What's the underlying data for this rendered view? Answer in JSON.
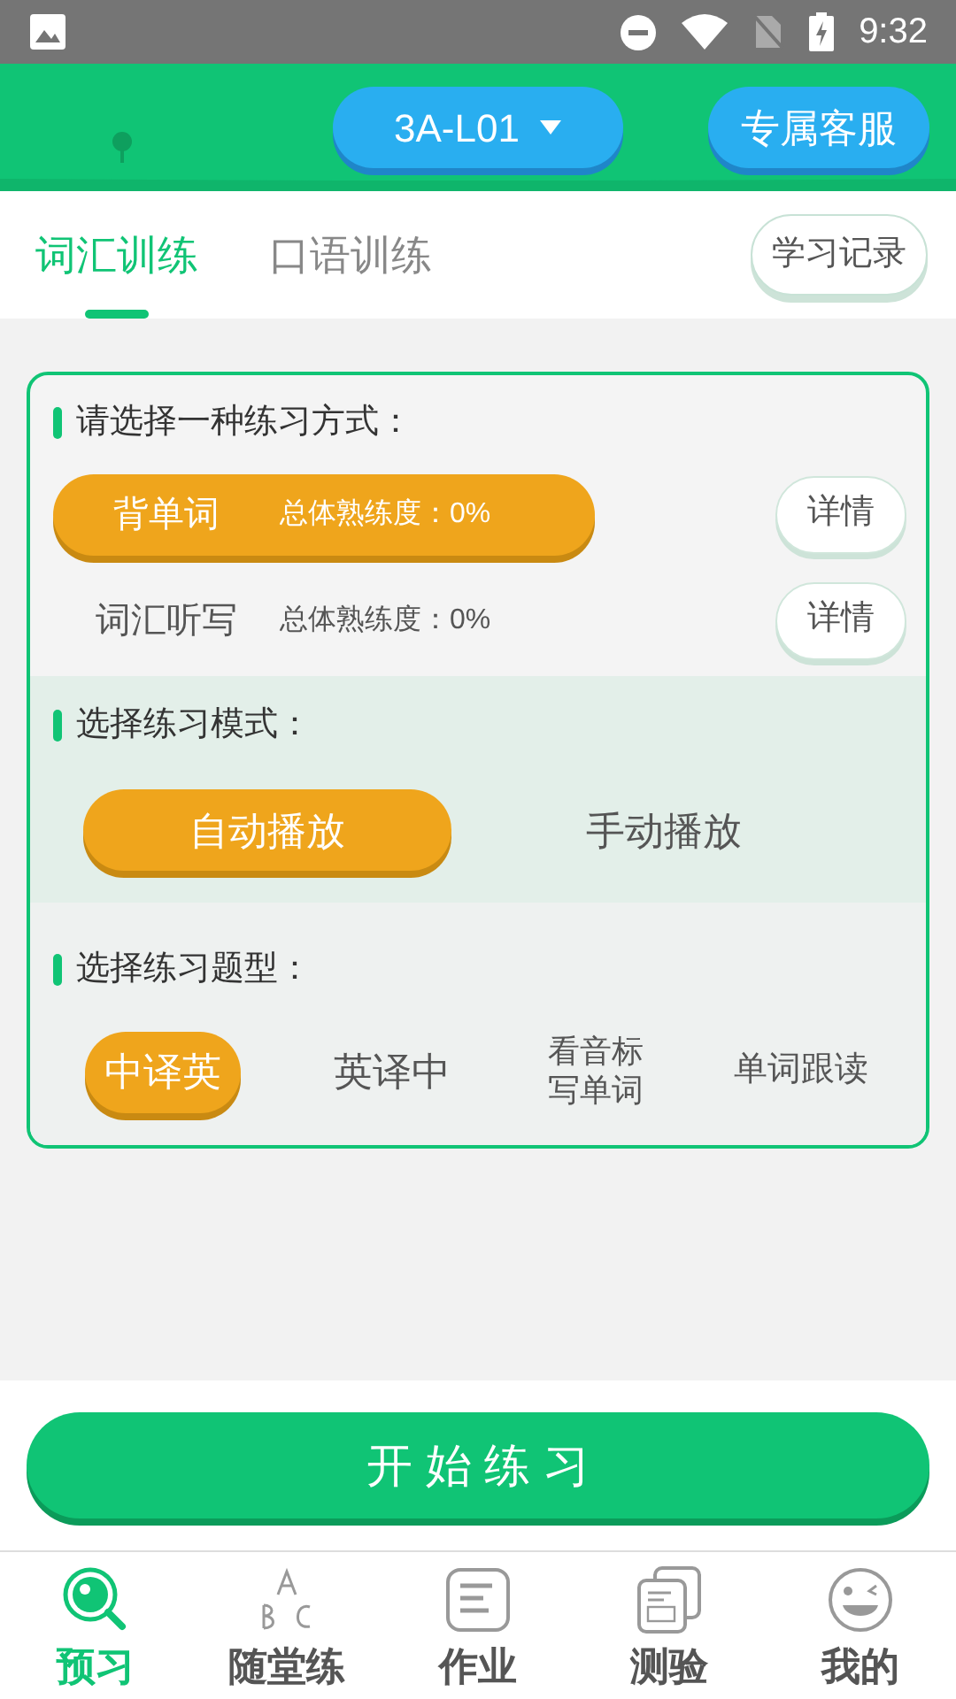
{
  "status_bar": {
    "time": "9:32"
  },
  "header": {
    "lesson": "3A-L01",
    "service_button": "专属客服"
  },
  "tabs": [
    {
      "label": "词汇训练",
      "selected": true
    },
    {
      "label": "口语训练",
      "selected": false
    }
  ],
  "history_button": "学习记录",
  "method_section": {
    "title": "请选择一种练习方式：",
    "options": [
      {
        "label": "背单词",
        "proficiency": "总体熟练度：0%",
        "detail": "详情",
        "selected": true
      },
      {
        "label": "词汇听写",
        "proficiency": "总体熟练度：0%",
        "detail": "详情",
        "selected": false
      }
    ]
  },
  "mode_section": {
    "title": "选择练习模式：",
    "options": [
      {
        "label": "自动播放",
        "selected": true
      },
      {
        "label": "手动播放",
        "selected": false
      }
    ]
  },
  "type_section": {
    "title": "选择练习题型：",
    "options": [
      {
        "label": "中译英",
        "selected": true
      },
      {
        "label": "英译中",
        "selected": false
      },
      {
        "label": "看音标写单词",
        "selected": false
      },
      {
        "label": "单词跟读",
        "selected": false
      }
    ]
  },
  "start_button": "开 始 练 习",
  "nav": [
    {
      "label": "预习",
      "selected": true
    },
    {
      "label": "随堂练",
      "selected": false
    },
    {
      "label": "作业",
      "selected": false
    },
    {
      "label": "测验",
      "selected": false
    },
    {
      "label": "我的",
      "selected": false
    }
  ]
}
